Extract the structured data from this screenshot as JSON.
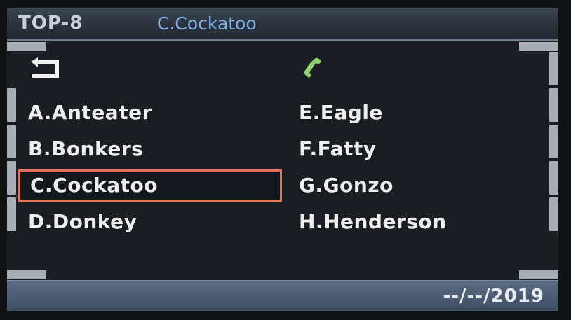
{
  "header": {
    "menu_title": "TOP-8",
    "selected_name": "C.Cockatoo"
  },
  "icons": {
    "back": "back-arrow-icon",
    "phone": "phone-icon",
    "phone_color": "#8fd16a"
  },
  "contacts": {
    "left": [
      {
        "label": "A.Anteater"
      },
      {
        "label": "B.Bonkers"
      },
      {
        "label": "C.Cockatoo",
        "selected": true
      },
      {
        "label": "D.Donkey"
      }
    ],
    "right": [
      {
        "label": "E.Eagle"
      },
      {
        "label": "F.Fatty"
      },
      {
        "label": "G.Gonzo"
      },
      {
        "label": "H.Henderson"
      }
    ]
  },
  "footer": {
    "date": "--/--/2019"
  },
  "colors": {
    "selection_border": "#e5735a",
    "header_accent": "#7fb0e8"
  }
}
